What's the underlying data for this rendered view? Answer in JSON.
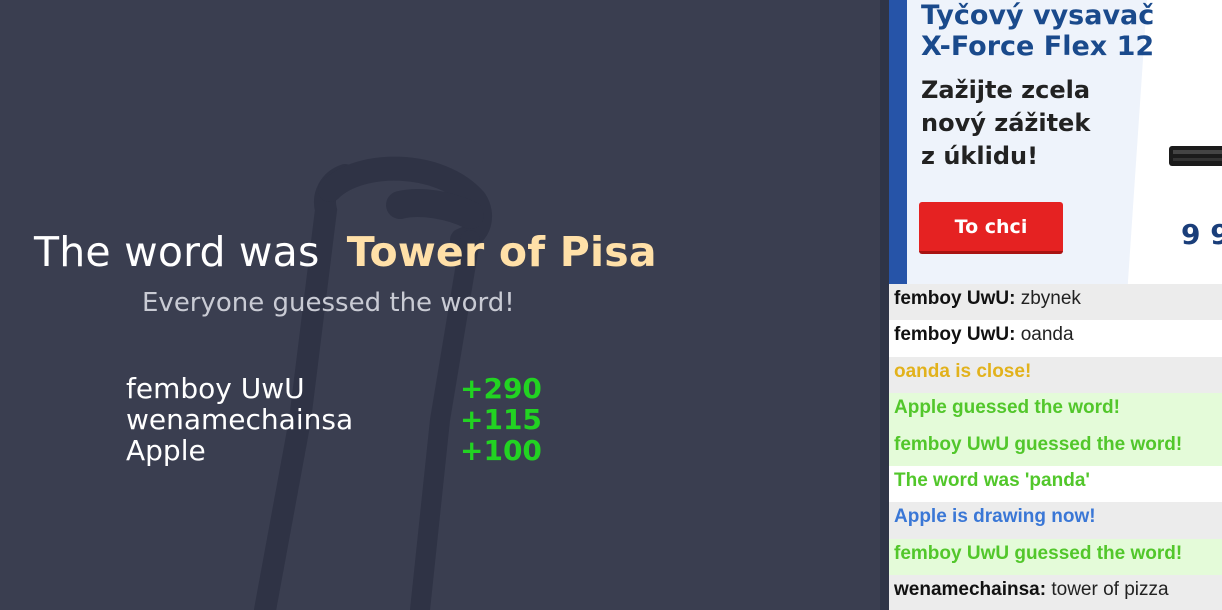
{
  "board": {
    "title_prefix": "The word was",
    "word": "Tower of Pisa",
    "subtitle": "Everyone guessed the word!",
    "scores": [
      {
        "name": "femboy UwU",
        "points": "+290"
      },
      {
        "name": "wenamechainsa",
        "points": "+115"
      },
      {
        "name": "Apple",
        "points": "+100"
      }
    ]
  },
  "ad": {
    "title_line1": "Tyčový vysavač",
    "title_line2": "X-Force Flex 12",
    "body_line1": "Zažijte zcela",
    "body_line2": "nový zážitek",
    "body_line3": "z úklidu!",
    "button": "To chci",
    "price": "9 9"
  },
  "chat": {
    "messages": [
      {
        "type": "chat",
        "sender": "femboy UwU:",
        "text": "zbynek"
      },
      {
        "type": "chat",
        "sender": "femboy UwU:",
        "text": "oanda"
      },
      {
        "type": "close",
        "text": "oanda is close!"
      },
      {
        "type": "guess",
        "text": "Apple guessed the word!"
      },
      {
        "type": "guess",
        "text": "femboy UwU guessed the word!"
      },
      {
        "type": "guess",
        "text": "The word was 'panda'"
      },
      {
        "type": "draw",
        "text": "Apple is drawing now!"
      },
      {
        "type": "guess",
        "text": "femboy UwU guessed the word!"
      },
      {
        "type": "chat",
        "sender": "wenamechainsa:",
        "text": "tower of pizza"
      }
    ]
  },
  "colors": {
    "board_bg": "#3a3e50",
    "word_highlight": "#ffe0a8",
    "points_green": "#22d322",
    "close_yellow": "#e2b21c",
    "guess_green": "#52c72b",
    "drawing_blue": "#3a77d6"
  }
}
